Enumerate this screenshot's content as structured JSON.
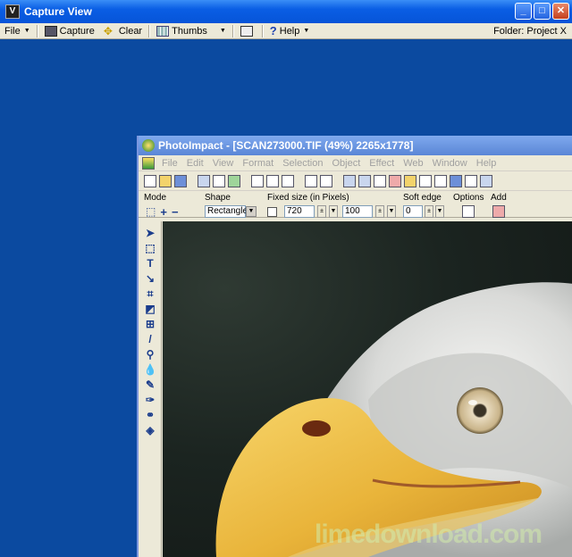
{
  "outer_window": {
    "title": "Capture View",
    "toolbar": {
      "file": "File",
      "capture": "Capture",
      "clear": "Clear",
      "thumbs": "Thumbs",
      "help": "Help",
      "folder": "Folder:  Project X"
    }
  },
  "inner_window": {
    "title": "PhotoImpact - [SCAN273000.TIF (49%) 2265x1778]",
    "menu": [
      "File",
      "Edit",
      "View",
      "Format",
      "Selection",
      "Object",
      "Effect",
      "Web",
      "Window",
      "Help"
    ],
    "attributes": {
      "mode_label": "Mode",
      "shape_label": "Shape",
      "shape_value": "Rectangle",
      "fixed_size_label": "Fixed size (in Pixels)",
      "width_value": "720",
      "height_value": "100",
      "soft_edge_label": "Soft edge",
      "soft_edge_value": "0",
      "options_label": "Options",
      "add_label": "Add"
    }
  },
  "watermark": "limedownload.com",
  "colors": {
    "desktop": "#0b4aa0",
    "titlebar": "#0654d8",
    "chrome": "#ece9d8"
  }
}
